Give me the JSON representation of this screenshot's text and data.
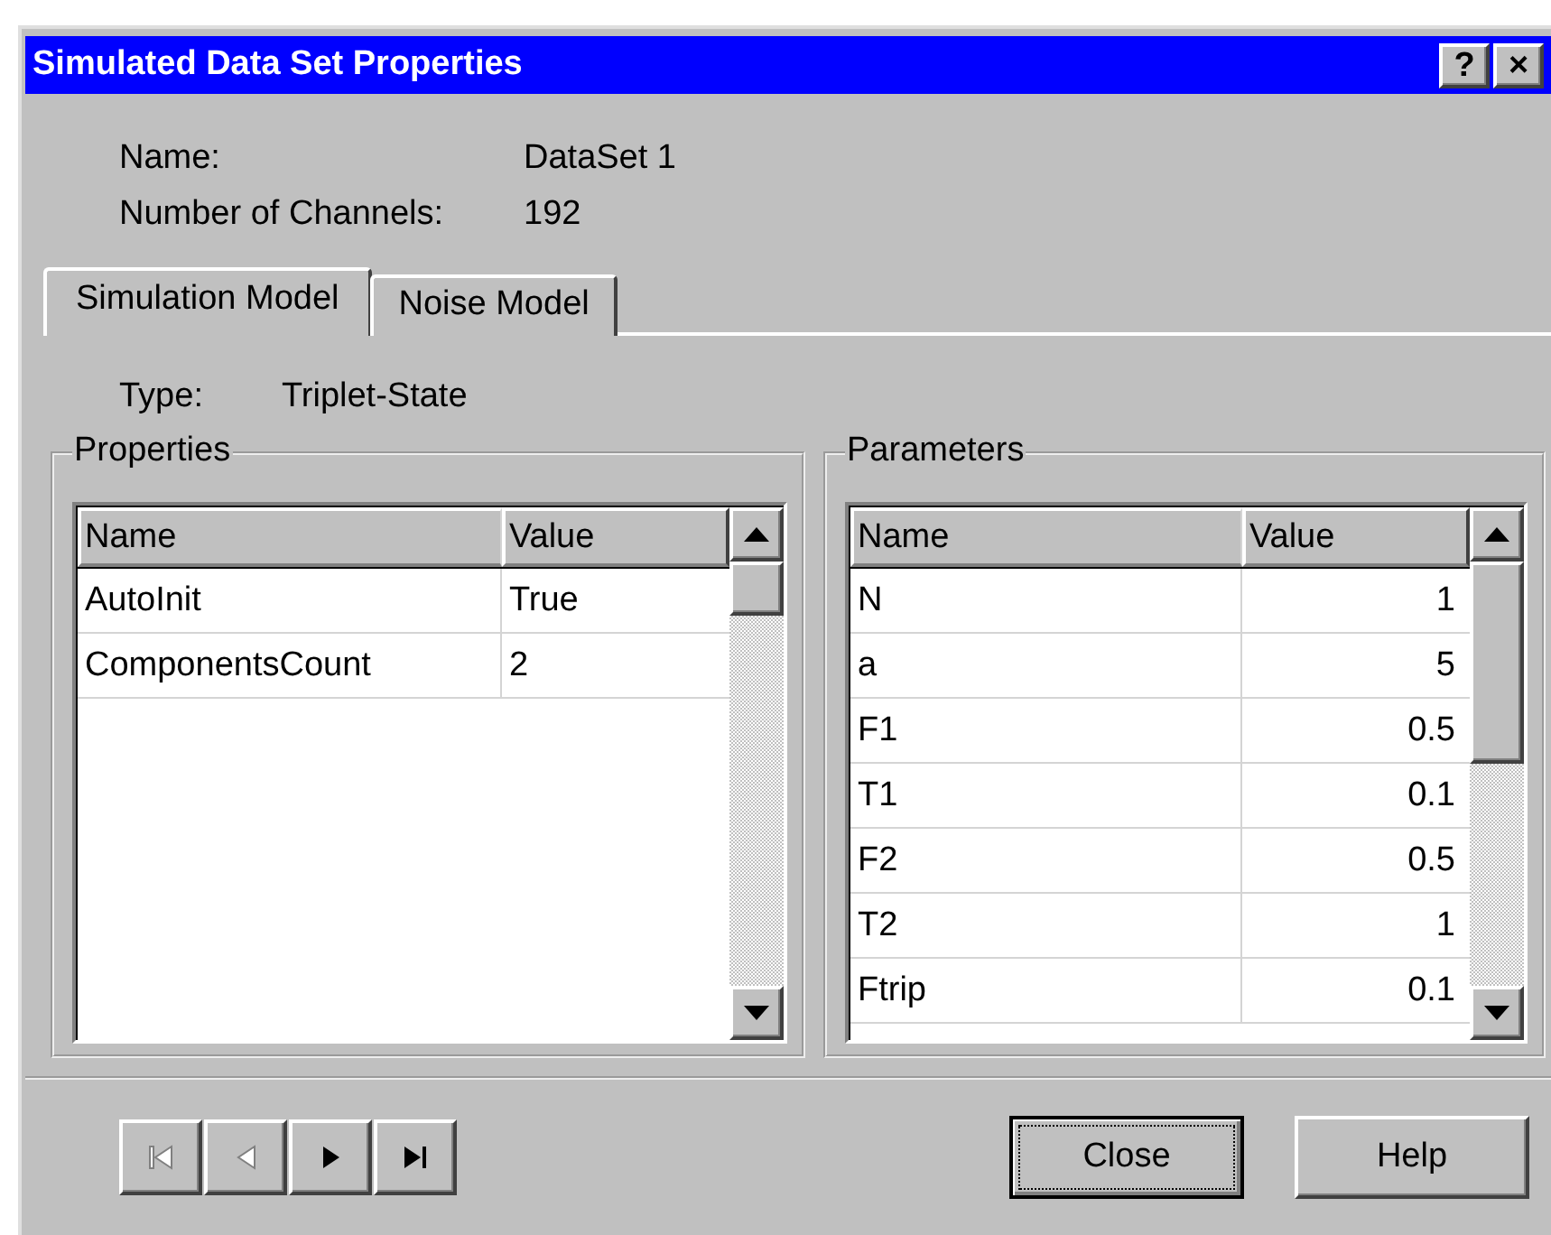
{
  "window": {
    "title": "Simulated Data Set Properties"
  },
  "title_buttons": [
    "?",
    "×"
  ],
  "info": [
    {
      "label": "Name:",
      "value": "DataSet 1"
    },
    {
      "label": "Number of Channels:",
      "value": "192"
    }
  ],
  "tabs": [
    {
      "label": "Simulation Model",
      "selected": true
    },
    {
      "label": "Noise Model",
      "selected": false
    }
  ],
  "type": {
    "label": "Type:",
    "value": "Triplet-State"
  },
  "groups": [
    {
      "title": "Properties",
      "numeric": false,
      "columns": [
        "Name",
        "Value"
      ],
      "rows": [
        [
          "AutoInit",
          "True"
        ],
        [
          "ComponentsCount",
          "2"
        ]
      ]
    },
    {
      "title": "Parameters",
      "numeric": true,
      "columns": [
        "Name",
        "Value"
      ],
      "rows": [
        [
          "N",
          "1"
        ],
        [
          "a",
          "5"
        ],
        [
          "F1",
          "0.5"
        ],
        [
          "T1",
          "0.1"
        ],
        [
          "F2",
          "0.5"
        ],
        [
          "T2",
          "1"
        ],
        [
          "Ftrip",
          "0.1"
        ]
      ]
    }
  ],
  "nav_buttons": [
    {
      "kind": "first",
      "disabled": true
    },
    {
      "kind": "prev",
      "disabled": true
    },
    {
      "kind": "next",
      "disabled": false
    },
    {
      "kind": "last",
      "disabled": false
    }
  ],
  "buttons": [
    {
      "label": "Close",
      "default": true
    },
    {
      "label": "Help",
      "default": false
    }
  ]
}
